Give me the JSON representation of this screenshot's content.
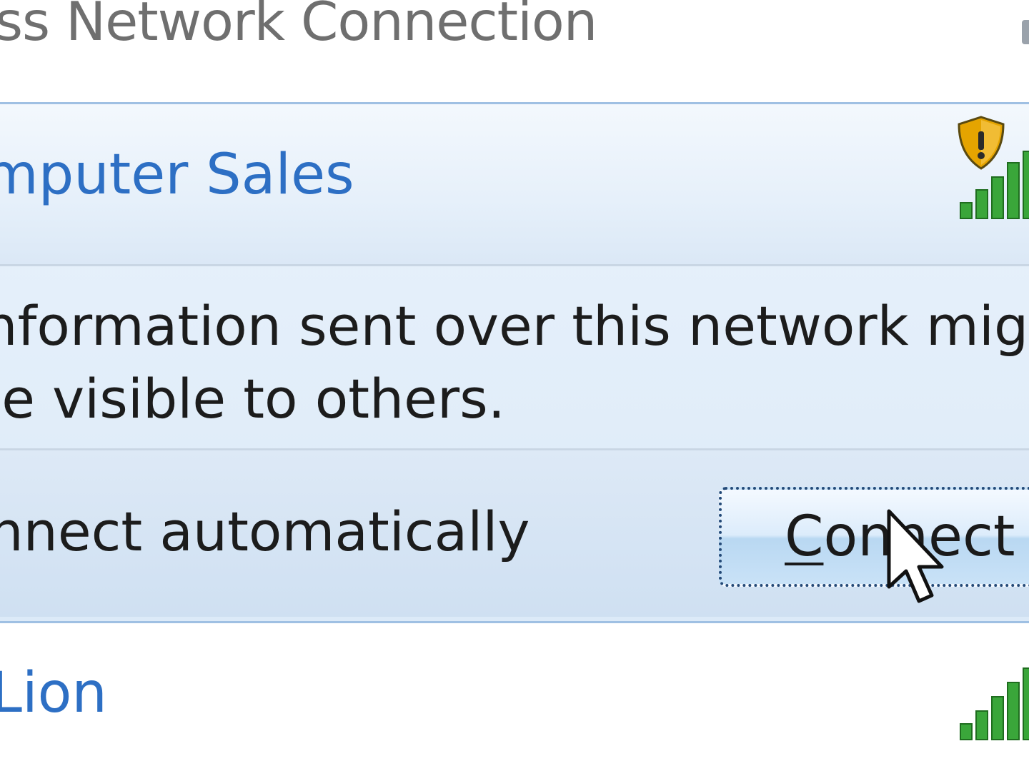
{
  "header": {
    "title": "less Network Connection"
  },
  "networks": [
    {
      "name": "omputer Sales",
      "security_warning_lines": [
        "Information sent over this network migh",
        "be visible to others."
      ],
      "connect_automatically_label": "onnect automatically",
      "connect_button": {
        "label_underlined": "C",
        "label_rest": "onnect"
      }
    },
    {
      "name": "gLion"
    }
  ],
  "icons": {
    "security": "shield-warning-icon",
    "signal": "signal-strength-icon",
    "cursor": "mouse-pointer-icon"
  },
  "colors": {
    "link": "#2d6fc4",
    "signal": "#3aa63a",
    "panel_border": "#9fc0e3",
    "shield": "#e5a400"
  }
}
